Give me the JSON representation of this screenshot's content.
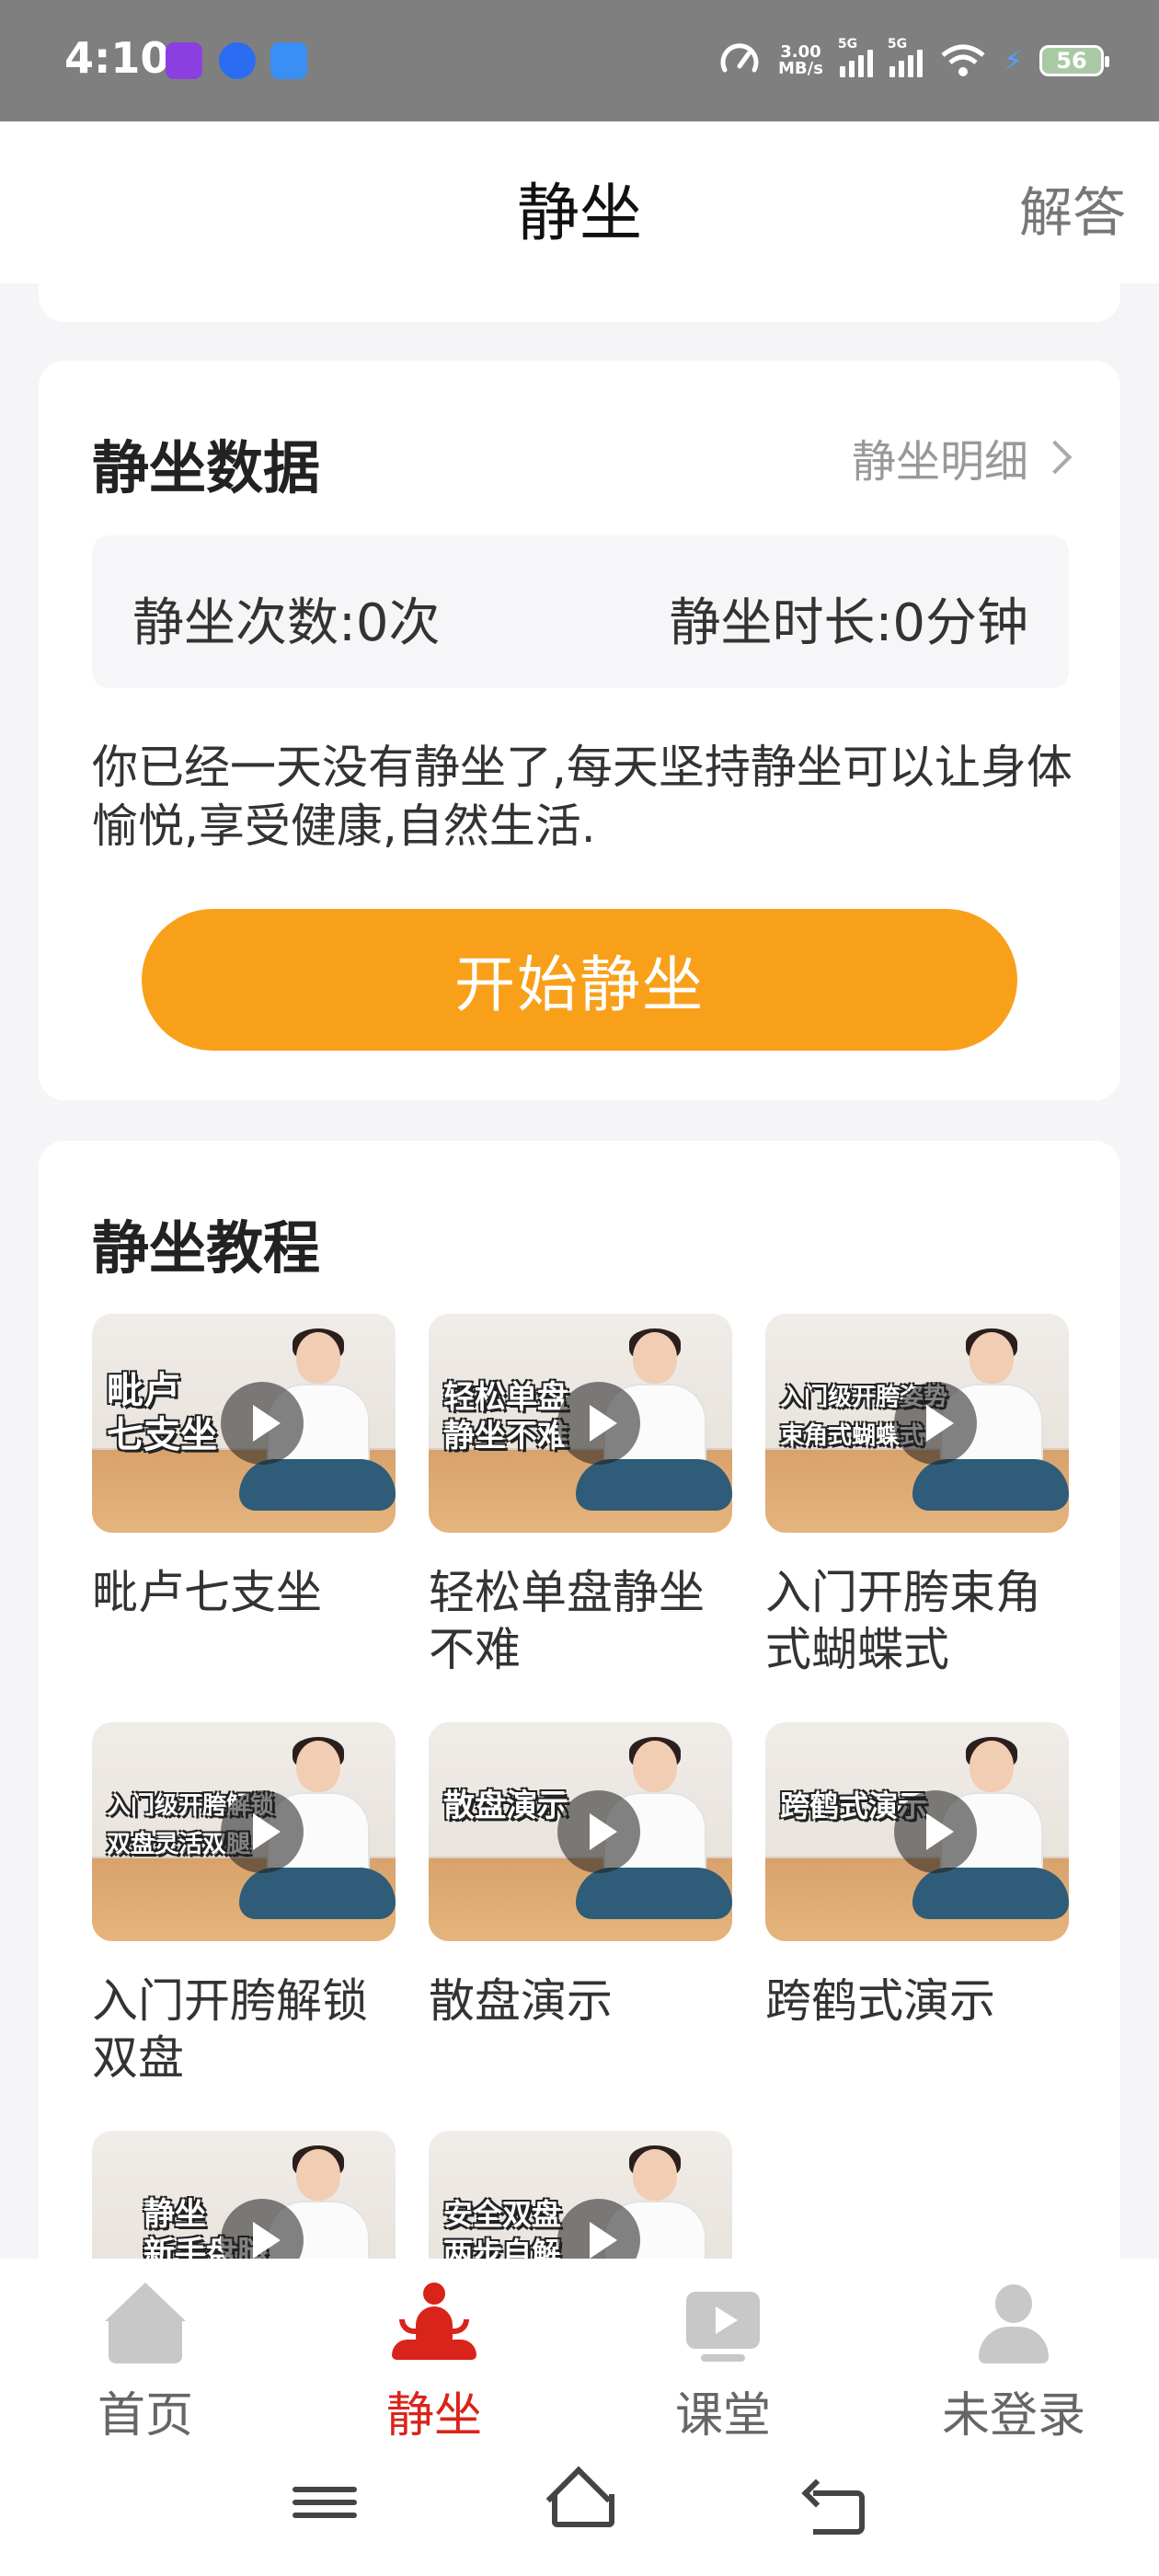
{
  "status_bar": {
    "time": "4:10",
    "speed_value": "3.00",
    "speed_unit": "MB/s",
    "signal_1": "5G",
    "signal_2": "5G",
    "battery": "56",
    "app_icon_colors": [
      "#8b3fe0",
      "#2a6df3",
      "#3a8ff5"
    ]
  },
  "header": {
    "title": "静坐",
    "answer_label": "解答"
  },
  "data_card": {
    "title": "静坐数据",
    "detail_link": "静坐明细",
    "count_stat": "静坐次数:0次",
    "duration_stat": "静坐时长:0分钟",
    "reminder": "你已经一天没有静坐了,每天坚持静坐可以让身体愉悦,享受健康,自然生活.",
    "start_button": "开始静坐"
  },
  "tutorial_card": {
    "title": "静坐教程",
    "items": [
      {
        "title": "毗卢七支坐",
        "thumb_text": "毗卢\n七支坐"
      },
      {
        "title": "轻松单盘静坐不难",
        "thumb_text": "轻松单盘\n静坐不难"
      },
      {
        "title": "入门开胯束角式蝴蝶式",
        "thumb_text": "入门级开胯姿势\n束角式蝴蝶式"
      },
      {
        "title": "入门开胯解锁双盘",
        "thumb_text": "入门级开胯解锁\n双盘灵活双腿"
      },
      {
        "title": "散盘演示",
        "thumb_text": "散盘演示"
      },
      {
        "title": "跨鹤式演示",
        "thumb_text": "跨鹤式演示"
      },
      {
        "title": "",
        "thumb_text": "静坐\n新手盘腿"
      },
      {
        "title": "",
        "thumb_text": "安全双盘\n两步自解"
      }
    ]
  },
  "bottom_nav": {
    "items": [
      {
        "label": "首页"
      },
      {
        "label": "静坐"
      },
      {
        "label": "课堂"
      },
      {
        "label": "未登录"
      }
    ],
    "active_color": "#d9241b"
  },
  "colors": {
    "accent": "#f9a01b"
  }
}
